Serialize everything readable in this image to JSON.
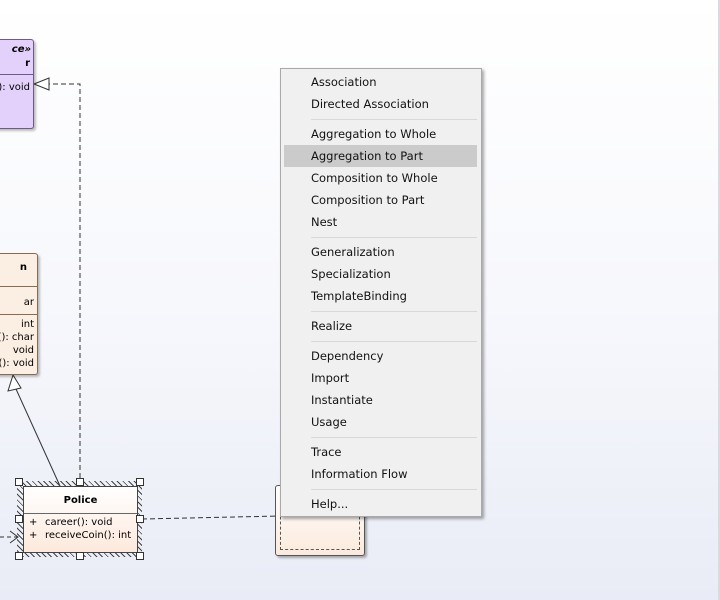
{
  "diagram": {
    "interface_class": {
      "stereotype": "ce»",
      "name": "r",
      "operation": "(): void"
    },
    "parent_class": {
      "name": "n",
      "attribute": "ar",
      "operations": [
        "int",
        "(): char",
        "void",
        "(): void"
      ]
    },
    "police_class": {
      "name": "Police",
      "operations": [
        {
          "visibility": "+",
          "signature": "career(): void"
        },
        {
          "visibility": "+",
          "signature": "receiveCoin(): int"
        }
      ]
    }
  },
  "context_menu": {
    "groups": [
      [
        "Association",
        "Directed Association"
      ],
      [
        "Aggregation to Whole",
        "Aggregation to Part",
        "Composition to Whole",
        "Composition to Part",
        "Nest"
      ],
      [
        "Generalization",
        "Specialization",
        "TemplateBinding"
      ],
      [
        "Realize"
      ],
      [
        "Dependency",
        "Import",
        "Instantiate",
        "Usage"
      ],
      [
        "Trace",
        "Information Flow"
      ],
      [
        "Help..."
      ]
    ],
    "highlighted": "Aggregation to Part"
  },
  "colors": {
    "interface_fill": "#e3d0fb",
    "class_fill": "#fbeee2",
    "menu_background": "#f0f0f0",
    "menu_highlight": "#cbcbcb"
  }
}
